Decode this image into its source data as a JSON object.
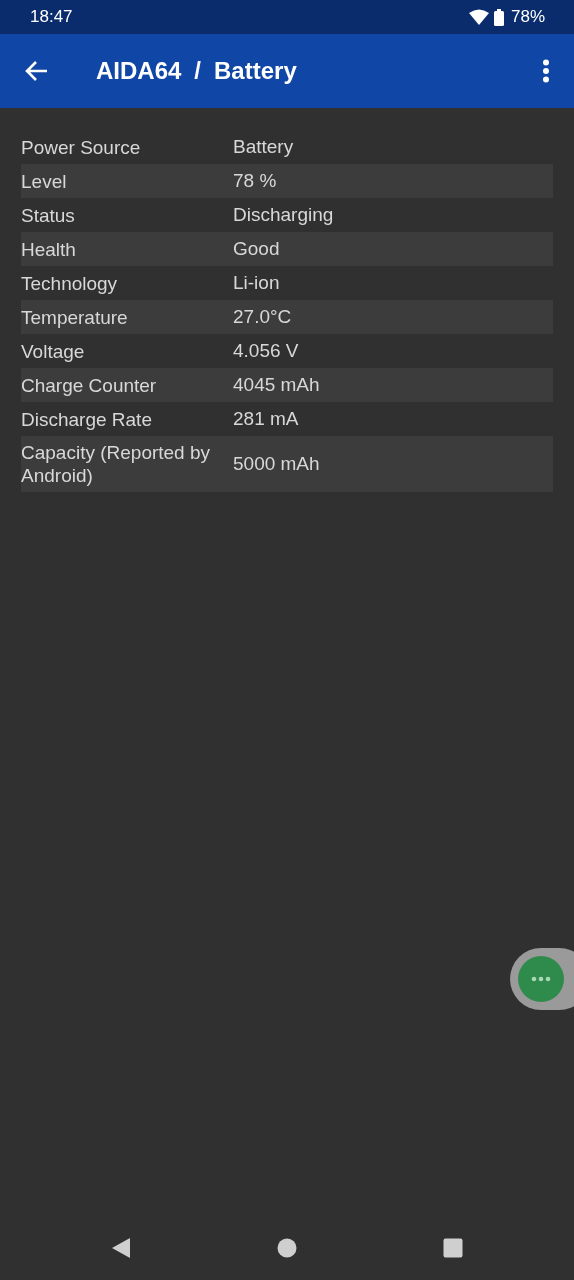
{
  "status_bar": {
    "time": "18:47",
    "battery": "78%"
  },
  "app_bar": {
    "title": "AIDA64",
    "separator": "/",
    "subtitle": "Battery"
  },
  "rows": [
    {
      "label": "Power Source",
      "value": "Battery"
    },
    {
      "label": "Level",
      "value": "78 %"
    },
    {
      "label": "Status",
      "value": "Discharging"
    },
    {
      "label": "Health",
      "value": "Good"
    },
    {
      "label": "Technology",
      "value": "Li-ion"
    },
    {
      "label": "Temperature",
      "value": "27.0°C"
    },
    {
      "label": "Voltage",
      "value": "4.056 V"
    },
    {
      "label": "Charge Counter",
      "value": "4045 mAh"
    },
    {
      "label": "Discharge Rate",
      "value": "281 mA"
    },
    {
      "label": "Capacity (Reported by Android)",
      "value": "5000 mAh"
    }
  ]
}
